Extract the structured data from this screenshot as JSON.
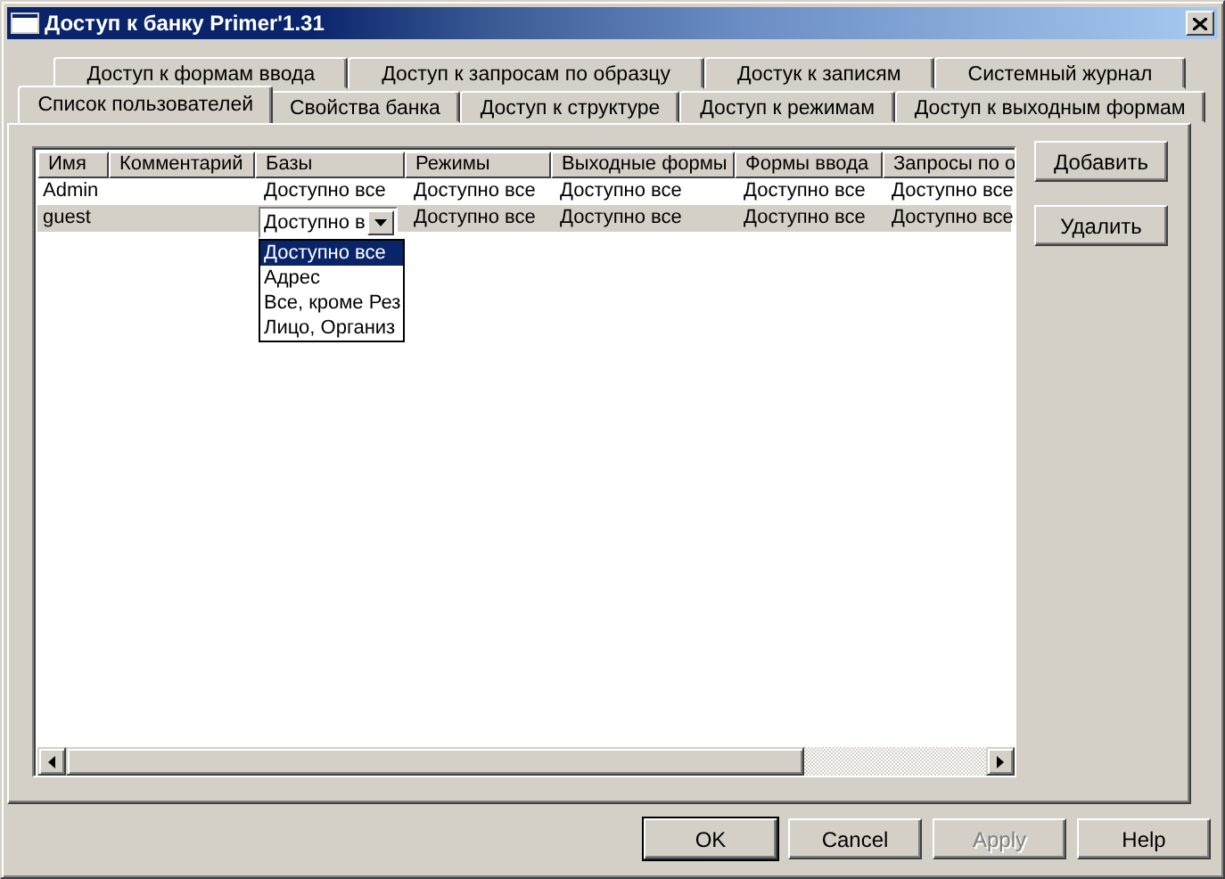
{
  "window": {
    "title": "Доступ к банку Primer'1.31"
  },
  "tab_rows": [
    {
      "tabs": [
        {
          "label": "Доступ к формам ввода",
          "selected": false
        },
        {
          "label": "Доступ к запросам по образцу",
          "selected": false
        },
        {
          "label": "Достук к записям",
          "selected": false
        },
        {
          "label": "Системный журнал",
          "selected": false
        }
      ]
    },
    {
      "tabs": [
        {
          "label": "Список пользователей",
          "selected": true
        },
        {
          "label": "Свойства банка",
          "selected": false
        },
        {
          "label": "Доступ к структуре",
          "selected": false
        },
        {
          "label": "Доступ к режимам",
          "selected": false
        },
        {
          "label": "Доступ к выходным формам",
          "selected": false
        }
      ]
    }
  ],
  "table": {
    "columns": [
      "Имя",
      "Комментарий",
      "Базы",
      "Режимы",
      "Выходные формы",
      "Формы ввода",
      "Запросы по о"
    ],
    "rows": [
      {
        "selected": false,
        "cells": [
          {
            "kind": "text",
            "text": "Admin"
          },
          {
            "kind": "text",
            "text": ""
          },
          {
            "kind": "text",
            "text": "Доступно все"
          },
          {
            "kind": "text",
            "text": "Доступно все"
          },
          {
            "kind": "text",
            "text": "Доступно все"
          },
          {
            "kind": "text",
            "text": "Доступно все"
          },
          {
            "kind": "text",
            "text": "Доступно все"
          }
        ]
      },
      {
        "selected": true,
        "cells": [
          {
            "kind": "text",
            "text": "guest"
          },
          {
            "kind": "text",
            "text": ""
          },
          {
            "kind": "combo",
            "value": "Доступно в",
            "options": [
              {
                "label": "Доступно все",
                "selected": true
              },
              {
                "label": "Адрес",
                "selected": false
              },
              {
                "label": "Все, кроме Рез",
                "selected": false
              },
              {
                "label": "Лицо, Организ",
                "selected": false
              }
            ]
          },
          {
            "kind": "text",
            "text": "Доступно все"
          },
          {
            "kind": "text",
            "text": "Доступно все"
          },
          {
            "kind": "text",
            "text": "Доступно все"
          },
          {
            "kind": "text",
            "text": "Доступно все"
          }
        ]
      }
    ]
  },
  "side_buttons": [
    "Добавить",
    "Удалить"
  ],
  "buttons": [
    {
      "label": "OK",
      "default": true,
      "disabled": false
    },
    {
      "label": "Cancel",
      "default": false,
      "disabled": false
    },
    {
      "label": "Apply",
      "default": false,
      "disabled": true
    },
    {
      "label": "Help",
      "default": false,
      "disabled": false
    }
  ]
}
